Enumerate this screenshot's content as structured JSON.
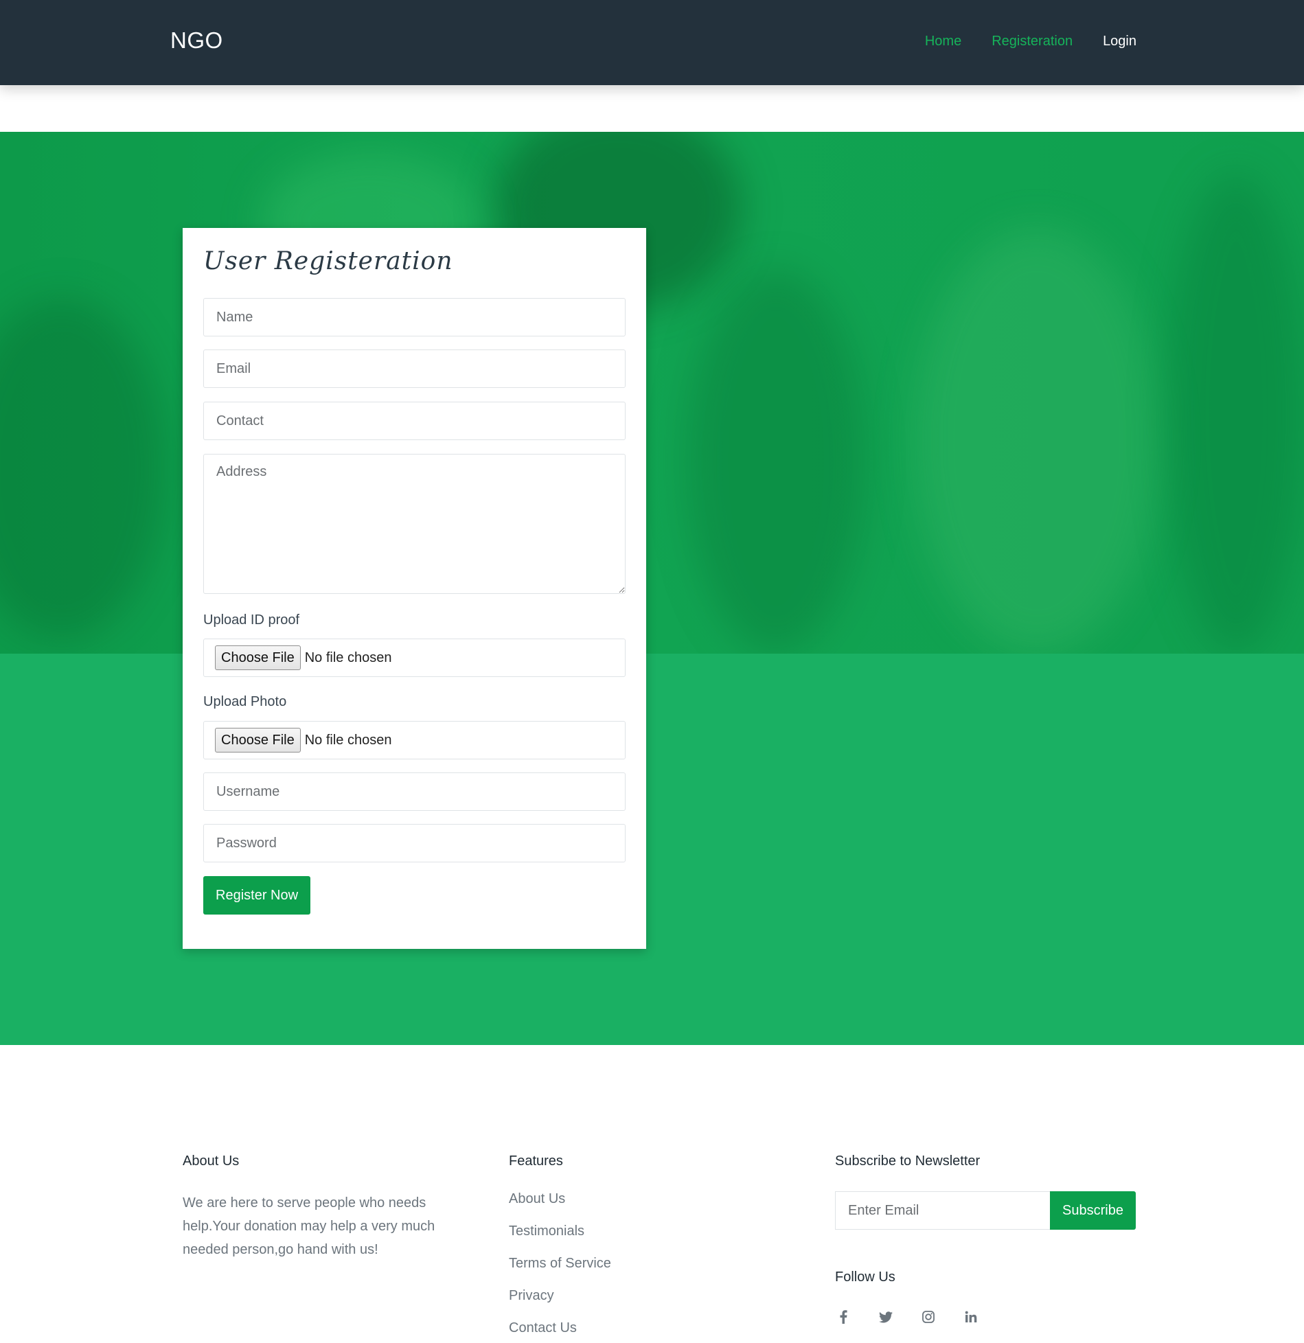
{
  "header": {
    "brand": "NGO",
    "nav": [
      {
        "label": "Home"
      },
      {
        "label": "Registeration"
      },
      {
        "label": "Login"
      }
    ]
  },
  "form": {
    "title": "User Registeration",
    "name_placeholder": "Name",
    "email_placeholder": "Email",
    "contact_placeholder": "Contact",
    "address_placeholder": "Address",
    "id_proof_label": "Upload ID proof",
    "photo_label": "Upload Photo",
    "choose_file_label": "Choose File",
    "no_file_text": "No file chosen",
    "username_placeholder": "Username",
    "password_placeholder": "Password",
    "submit_label": "Register Now"
  },
  "footer": {
    "about": {
      "heading": "About Us",
      "text": "We are here to serve people who needs help.Your donation may help a very much needed person,go hand with us!"
    },
    "features": {
      "heading": "Features",
      "links": [
        "About Us",
        "Testimonials",
        "Terms of Service",
        "Privacy",
        "Contact Us"
      ]
    },
    "newsletter": {
      "heading": "Subscribe to Newsletter",
      "email_placeholder": "Enter Email",
      "button_label": "Subscribe",
      "follow_heading": "Follow Us",
      "social_icons": [
        "facebook-icon",
        "twitter-icon",
        "instagram-icon",
        "linkedin-icon"
      ]
    }
  },
  "colors": {
    "navbar_bg": "#23313c",
    "accent_green": "#0c9f4c",
    "band_green": "#1ab063",
    "nav_link_green": "#16b35a"
  }
}
